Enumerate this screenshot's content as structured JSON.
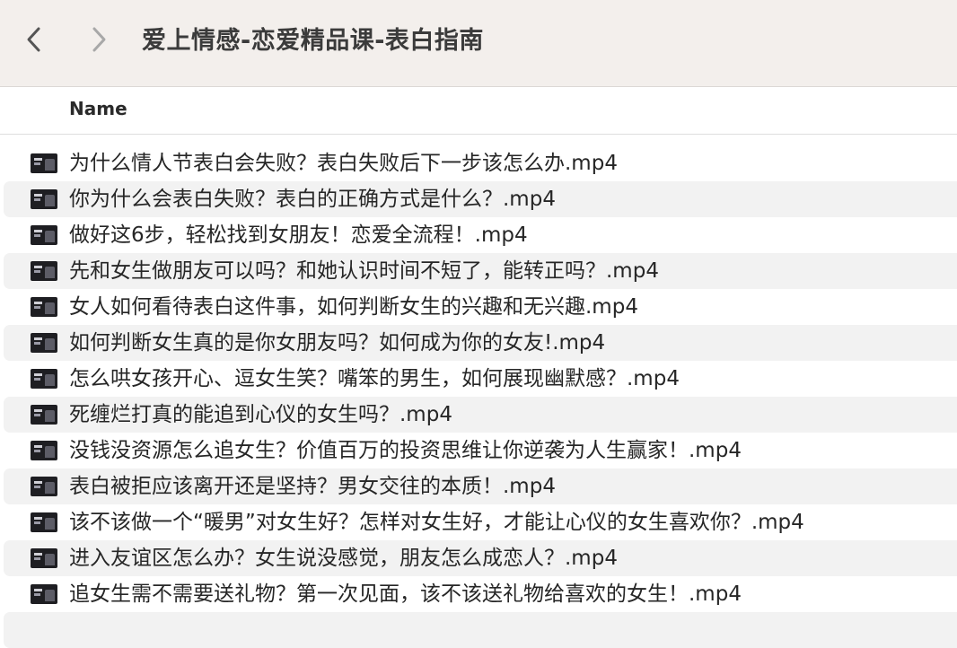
{
  "window": {
    "title": "爱上情感-恋爱精品课-表白指南"
  },
  "toolbar": {
    "back_icon": "chevron-left-icon",
    "forward_icon": "chevron-right-icon"
  },
  "columns": {
    "name_label": "Name"
  },
  "files": [
    {
      "name": "为什么情人节表白会失败？表白失败后下一步该怎么办.mp4",
      "icon": "video-thumbnail-icon"
    },
    {
      "name": "你为什么会表白失败？表白的正确方式是什么？.mp4",
      "icon": "video-thumbnail-icon"
    },
    {
      "name": "做好这6步，轻松找到女朋友！恋爱全流程！.mp4",
      "icon": "video-thumbnail-icon"
    },
    {
      "name": "先和女生做朋友可以吗？和她认识时间不短了，能转正吗？.mp4",
      "icon": "video-thumbnail-icon"
    },
    {
      "name": "女人如何看待表白这件事，如何判断女生的兴趣和无兴趣.mp4",
      "icon": "video-thumbnail-icon"
    },
    {
      "name": "如何判断女生真的是你女朋友吗？如何成为你的女友!.mp4",
      "icon": "video-thumbnail-icon"
    },
    {
      "name": "怎么哄女孩开心、逗女生笑？嘴笨的男生，如何展现幽默感？.mp4",
      "icon": "video-thumbnail-icon"
    },
    {
      "name": "死缠烂打真的能追到心仪的女生吗？.mp4",
      "icon": "video-thumbnail-icon"
    },
    {
      "name": "没钱没资源怎么追女生？价值百万的投资思维让你逆袭为人生赢家！.mp4",
      "icon": "video-thumbnail-icon"
    },
    {
      "name": "表白被拒应该离开还是坚持？男女交往的本质！.mp4",
      "icon": "video-thumbnail-icon"
    },
    {
      "name": "该不该做一个“暖男”对女生好？怎样对女生好，才能让心仪的女生喜欢你？.mp4",
      "icon": "video-thumbnail-icon"
    },
    {
      "name": "进入友谊区怎么办？女生说没感觉，朋友怎么成恋人？.mp4",
      "icon": "video-thumbnail-icon"
    },
    {
      "name": "追女生需不需要送礼物？第一次见面，该不该送礼物给喜欢的女生！.mp4",
      "icon": "video-thumbnail-icon"
    }
  ],
  "colors": {
    "toolbar_bg": "#f3efec",
    "stripe": "#f2f2f2",
    "text": "#262626"
  }
}
